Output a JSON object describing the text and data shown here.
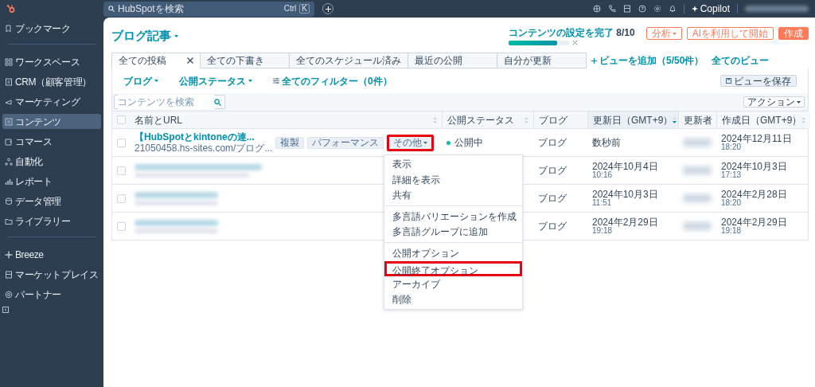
{
  "topbar": {
    "search": {
      "placeholder": "HubSpotを検索",
      "shortcut": [
        "Ctrl",
        "K"
      ]
    },
    "copilot": "Copilot"
  },
  "sidebar": {
    "groups": [
      [
        {
          "label": "ブックマーク",
          "selected": false
        }
      ],
      [
        {
          "label": "ワークスペース",
          "selected": false
        },
        {
          "label": "CRM（顧客管理）",
          "selected": false
        },
        {
          "label": "マーケティング",
          "selected": false
        },
        {
          "label": "コンテンツ",
          "selected": true
        },
        {
          "label": "コマース",
          "selected": false
        },
        {
          "label": "自動化",
          "selected": false
        },
        {
          "label": "レポート",
          "selected": false
        },
        {
          "label": "データ管理",
          "selected": false
        },
        {
          "label": "ライブラリー",
          "selected": false
        }
      ],
      [
        {
          "label": "Breeze",
          "selected": false
        },
        {
          "label": "マーケットプレイス",
          "selected": false
        },
        {
          "label": "パートナー",
          "selected": false
        }
      ]
    ]
  },
  "page": {
    "title": "ブログ記事"
  },
  "onboarding": {
    "label": "コンテンツの設定を完了",
    "count": "8/10",
    "level": 0.8
  },
  "header_buttons": [
    {
      "label": "分析",
      "kind": "outline",
      "caret": true
    },
    {
      "label": "AIを利用して開始",
      "kind": "outline",
      "caret": false
    },
    {
      "label": "作成",
      "kind": "primary",
      "caret": false
    }
  ],
  "tabs": [
    {
      "label": "全ての投稿",
      "selected": true
    },
    {
      "label": "全ての下書き",
      "selected": false
    },
    {
      "label": "全てのスケジュール済み",
      "selected": false
    },
    {
      "label": "最近の公開",
      "selected": false
    },
    {
      "label": "自分が更新",
      "selected": false
    }
  ],
  "add_view": "ビューを追加（5/50件）",
  "all_views": "全てのビュー",
  "filters": [
    {
      "label": "ブログ",
      "kind": "dropdown"
    },
    {
      "label": "公開ステータス",
      "kind": "dropdown"
    },
    {
      "label": "全てのフィルター（0件）",
      "kind": "filter"
    }
  ],
  "save_view": "ビューを保存",
  "content_search": {
    "placeholder": "コンテンツを検索"
  },
  "actions_button": "アクション",
  "table": {
    "all_checked": false,
    "columns": [
      {
        "label": "名前とURL",
        "sortable": true,
        "sorted": false
      },
      {
        "label": "公開ステータス",
        "sortable": true,
        "sorted": false
      },
      {
        "label": "ブログ",
        "sortable": false,
        "sorted": false
      },
      {
        "label": "更新日（GMT+9）",
        "sortable": true,
        "sorted": true
      },
      {
        "label": "更新者",
        "sortable": false,
        "sorted": false
      },
      {
        "label": "作成日（GMT+9）",
        "sortable": true,
        "sorted": false
      }
    ],
    "rows": [
      {
        "checked": false,
        "title": "【HubSpotとkintoneの連...",
        "url": "21050458.hs-sites.com/ブログ...",
        "actions": [
          {
            "label": "複製",
            "caret": false,
            "highlighted": false
          },
          {
            "label": "パフォーマンス",
            "caret": false,
            "highlighted": false
          },
          {
            "label": "その他",
            "caret": true,
            "highlighted": true
          }
        ],
        "status": "公開中",
        "blog": "ブログ",
        "updated": {
          "date": "数秒前"
        },
        "created": {
          "date": "2024年12月11日",
          "time": "18:20"
        }
      },
      {
        "checked": false,
        "blog": "ブログ",
        "updated": {
          "date": "2024年10月4日",
          "time": "10:16"
        },
        "created": {
          "date": "2024年10月3日",
          "time": "17:13"
        }
      },
      {
        "checked": false,
        "blog": "ブログ",
        "updated": {
          "date": "2024年10月3日",
          "time": "11:51"
        },
        "created": {
          "date": "2024年2月28日",
          "time": "18:20"
        }
      },
      {
        "checked": false,
        "blog": "ブログ",
        "updated": {
          "date": "2024年2月29日",
          "time": "19:18"
        },
        "created": {
          "date": "2024年2月29日",
          "time": "19:18"
        }
      }
    ]
  },
  "menu": {
    "groups": [
      [
        {
          "label": "表示",
          "highlighted": false
        },
        {
          "label": "詳細を表示",
          "highlighted": false
        },
        {
          "label": "共有",
          "highlighted": false
        }
      ],
      [
        {
          "label": "多言語バリエーションを作成",
          "highlighted": false
        },
        {
          "label": "多言語グループに追加",
          "highlighted": false
        }
      ],
      [
        {
          "label": "公開オプション",
          "highlighted": false
        },
        {
          "label": "公開終了オプション",
          "highlighted": true
        },
        {
          "label": "アーカイブ",
          "highlighted": false
        },
        {
          "label": "削除",
          "highlighted": false
        }
      ]
    ]
  }
}
